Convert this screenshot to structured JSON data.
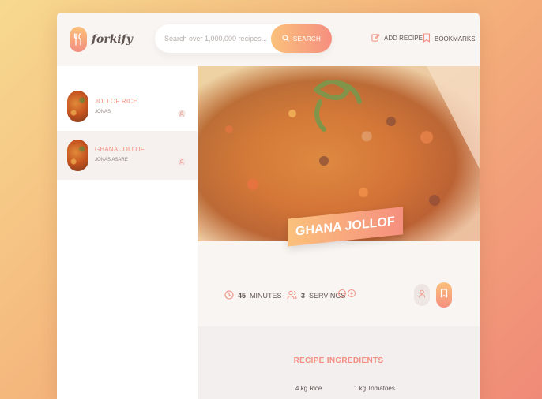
{
  "header": {
    "logo_text": "forkify",
    "search_placeholder": "Search over 1,000,000 recipes...",
    "search_button": "SEARCH",
    "nav_add": "ADD RECIPE",
    "nav_bookmarks": "BOOKMARKS"
  },
  "sidebar": {
    "results": [
      {
        "title": "JOLLOF RICE",
        "publisher": "JONAS"
      },
      {
        "title": "GHANA JOLLOF",
        "publisher": "JONAS ASARE"
      }
    ]
  },
  "recipe": {
    "title": "GHANA JOLLOF",
    "time_value": "45",
    "time_unit": "MINUTES",
    "servings_value": "3",
    "servings_unit": "SERVINGS",
    "ingredients_heading": "RECIPE INGREDIENTS",
    "ingredients": [
      "4 kg Rice",
      "1 kg Tomatoes"
    ]
  },
  "colors": {
    "accent": "#f38e82",
    "gradient_start": "#fbc17c",
    "gradient_end": "#f58f7f"
  }
}
